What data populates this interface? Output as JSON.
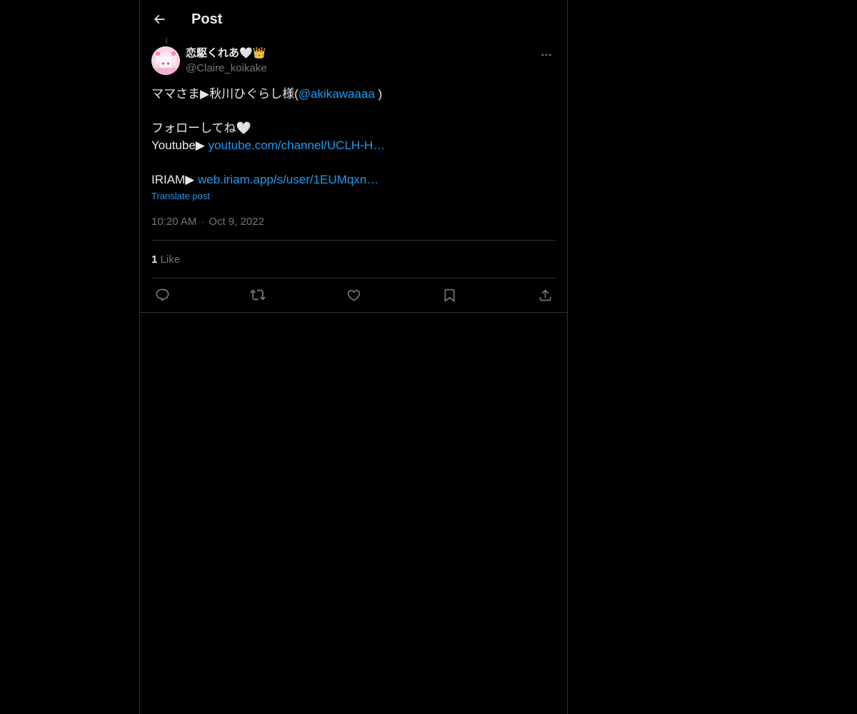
{
  "header": {
    "title": "Post"
  },
  "post": {
    "author": {
      "display_name": "恋駆くれあ🤍👑",
      "handle": "@Claire_koikake"
    },
    "text": {
      "line1_prefix": "ママさま▶秋川ひぐらし様(",
      "line1_mention": "@akikawaaaa",
      "line1_suffix": " )",
      "line2": "フォローしてね🤍",
      "line3_prefix": "Youtube▶ ",
      "line3_link": "youtube.com/channel/UCLH-H…",
      "line4_prefix": "IRIAM▶ ",
      "line4_link": "web.iriam.app/s/user/1EUMqxn…"
    },
    "translate_label": "Translate post",
    "time": "10:20 AM",
    "separator": "·",
    "date": "Oct 9, 2022",
    "likes_count": "1",
    "likes_label": "Like"
  },
  "actions": {
    "reply": "reply-icon",
    "repost": "repost-icon",
    "like": "heart-icon",
    "bookmark": "bookmark-icon",
    "share": "share-icon"
  },
  "colors": {
    "background": "#000000",
    "text_primary": "#e7e9ea",
    "text_secondary": "#71767b",
    "link": "#1d9bf0",
    "border": "#2f3336"
  }
}
